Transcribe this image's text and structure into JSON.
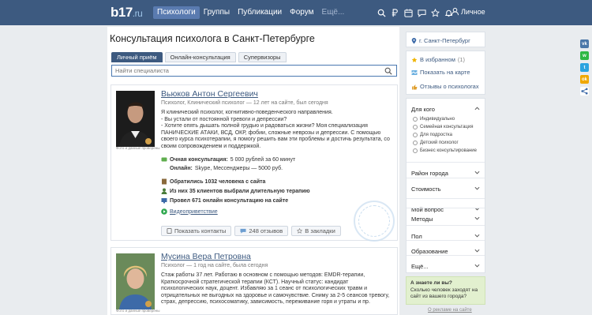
{
  "header": {
    "logo_main": "b17",
    "logo_suffix": ".ru",
    "nav": [
      {
        "label": "Психологи",
        "active": true
      },
      {
        "label": "Группы",
        "active": false
      },
      {
        "label": "Публикации",
        "active": false
      },
      {
        "label": "Форум",
        "active": false
      },
      {
        "label": "Ещё...",
        "active": false
      }
    ],
    "account_label": "Личное",
    "icons": [
      "search-icon",
      "ruble-icon",
      "calendar-icon",
      "chat-icon",
      "star-icon",
      "bell-icon",
      "user-icon"
    ]
  },
  "page": {
    "title": "Консультация психолога в Санкт-Петербурге",
    "tabs": [
      {
        "label": "Личный приём",
        "active": true
      },
      {
        "label": "Онлайн-консультация",
        "active": false
      },
      {
        "label": "Супервизоры",
        "active": false
      }
    ],
    "search_placeholder": "Найти специалиста"
  },
  "cards": [
    {
      "name": "Вьюков Антон Сергеевич",
      "meta": "Психолог, Клинический психолог — 12 лет на сайте, был сегодня",
      "verified": "Фото и данные проверены",
      "description": [
        "Я клинический психолог, когнитивно-поведенческого направления.",
        "- Вы устали от постоянной тревоги и депрессии?",
        "- Хотите опять дышать полной грудью и радоваться жизни? Моя специализация ПАНИЧЕСКИЕ АТАКИ, ВСД, ОКР, фобии, сложные неврозы и депрессии. С помощью своего курса психотерапии, я помогу решить вам эти проблемы и достичь результата, со своим сопровождением и поддержкой."
      ],
      "in_person_label": "Очная консультация:",
      "in_person_value": "5 000 рублей за 60 минут",
      "online_label": "Онлайн:",
      "online_value": "Skype, Мессенджеры — 5000 руб.",
      "stat1": "Обратились 1032 человека с сайта",
      "stat2": "Из них 35 клиентов выбрали длительную терапию",
      "stat3": "Провел 671 онлайн консультацию на сайте",
      "video_label": "Видеоприветствие",
      "btn_contacts": "Показать контакты",
      "btn_reviews": "248 отзывов",
      "btn_bookmark": "В закладки"
    },
    {
      "name": "Мусина Вера Петровна",
      "meta": "Психолог — 1 год на сайте, была сегодня",
      "verified": "Фото и данные проверены",
      "description": "Стаж работы 37 лет. Работаю в основном с помощью методов: EMDR-терапии, Краткосрочной стратегической терапии (КСТ). Научный статус: кандидат психологических наук, доцент. Избавляю за 1 сеанс от психологических травм и отрицательных не выгодных на здоровье и самочувствие. Сниму за 2-5 сеансов тревогу, страх, депрессию, психосоматику, зависимость, переживание горя и утраты и пр."
    }
  ],
  "sidebar": {
    "location": "г. Санкт-Петербург",
    "favorites": "В избранном",
    "favorites_count": "(1)",
    "map": "Показать на карте",
    "reviews": "Отзывы о психологах",
    "filter_title": "Для кого",
    "options": [
      "Индивидуально",
      "Семейная консультация",
      "Для подростка",
      "Детский психолог",
      "Бизнес консультирование"
    ],
    "sections": [
      "Район города",
      "Стоимость",
      "Мой вопрос",
      "Методы",
      "Пол",
      "Образование",
      "Ещё..."
    ],
    "know_title": "А знаете ли вы?",
    "know_text": "Сколько человек заходят на сайт из вашего города?",
    "adv": "О рекламе на сайте"
  },
  "colors": {
    "header": "#3d5a80",
    "link": "#3d5a80",
    "know_bg": "#e2f0cf"
  }
}
